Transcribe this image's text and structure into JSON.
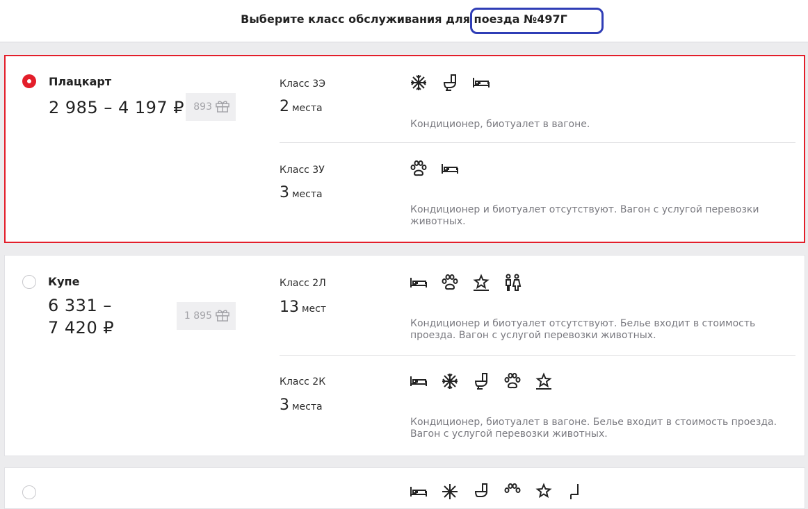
{
  "header": {
    "title": "Выберите класс обслуживания для поезда №497Г"
  },
  "cards": [
    {
      "name": "Плацкарт",
      "price_line1": "2 985 – 4 197 ₽",
      "price_line2": "",
      "bonus": "893",
      "selected": true,
      "rows": [
        {
          "class_label": "Класс 3Э",
          "seats_num": "2",
          "seats_word": "места",
          "icons": [
            "snowflake-icon",
            "toilet-icon",
            "bed-icon"
          ],
          "desc": "Кондиционер, биотуалет в вагоне."
        },
        {
          "class_label": "Класс 3У",
          "seats_num": "3",
          "seats_word": "места",
          "icons": [
            "paw-icon",
            "bed-icon"
          ],
          "desc": "Кондиционер и биотуалет отсутствуют. Вагон с услугой перевозки животных."
        }
      ]
    },
    {
      "name": "Купе",
      "price_line1": "6 331 –",
      "price_line2": "7 420 ₽",
      "bonus": "1 895",
      "selected": false,
      "rows": [
        {
          "class_label": "Класс 2Л",
          "seats_num": "13",
          "seats_word": "мест",
          "icons": [
            "bed-icon",
            "paw-icon",
            "star-icon",
            "people-icon"
          ],
          "desc": "Кондиционер и биотуалет отсутствуют. Белье входит в стоимость проезда. Вагон с услугой перевозки животных."
        },
        {
          "class_label": "Класс 2К",
          "seats_num": "3",
          "seats_word": "места",
          "icons": [
            "bed-icon",
            "snowflake-icon",
            "toilet-icon",
            "paw-icon",
            "star-icon"
          ],
          "desc": "Кондиционер, биотуалет в вагоне. Белье входит в стоимость проезда. Вагон с услугой перевозки животных."
        }
      ]
    },
    {
      "name": "",
      "icons": [
        "bed-icon",
        "snowflake-icon",
        "toilet-icon",
        "paw-icon",
        "star-icon",
        "seat-icon"
      ]
    }
  ],
  "colors": {
    "accent": "#e31e2a",
    "annotation": "#2f3db6",
    "muted": "#7a7a80"
  }
}
